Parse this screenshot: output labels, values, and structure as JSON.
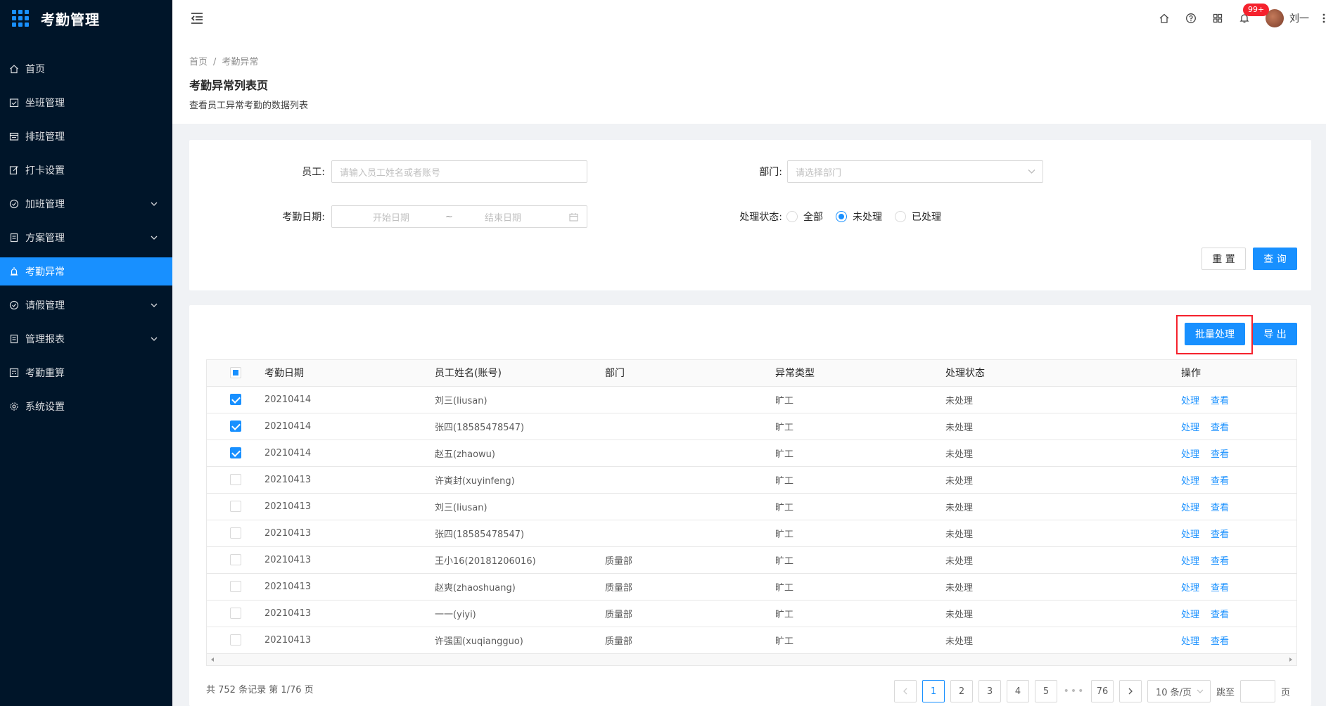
{
  "app": {
    "title": "考勤管理"
  },
  "sidebar": {
    "items": [
      {
        "label": "首页",
        "icon": "home-icon"
      },
      {
        "label": "坐班管理",
        "icon": "calendar-check-icon"
      },
      {
        "label": "排班管理",
        "icon": "schedule-icon"
      },
      {
        "label": "打卡设置",
        "icon": "edit-icon"
      },
      {
        "label": "加班管理",
        "icon": "clock-icon",
        "expandable": true
      },
      {
        "label": "方案管理",
        "icon": "document-icon",
        "expandable": true
      },
      {
        "label": "考勤异常",
        "icon": "alert-icon",
        "active": true
      },
      {
        "label": "请假管理",
        "icon": "clock-icon",
        "expandable": true
      },
      {
        "label": "管理报表",
        "icon": "document-icon",
        "expandable": true
      },
      {
        "label": "考勤重算",
        "icon": "calculator-icon"
      },
      {
        "label": "系统设置",
        "icon": "gear-icon"
      }
    ]
  },
  "header": {
    "notification_count": "99+",
    "user_name": "刘一"
  },
  "page": {
    "breadcrumb": [
      "首页",
      "考勤异常"
    ],
    "breadcrumb_sep": "/",
    "title": "考勤异常列表页",
    "description": "查看员工异常考勤的数据列表"
  },
  "search": {
    "employee_label": "员工:",
    "employee_placeholder": "请输入员工姓名或者账号",
    "dept_label": "部门:",
    "dept_placeholder": "请选择部门",
    "date_label": "考勤日期:",
    "start_placeholder": "开始日期",
    "range_sep": "~",
    "end_placeholder": "结束日期",
    "status_label": "处理状态:",
    "status_options": [
      "全部",
      "未处理",
      "已处理"
    ],
    "status_selected": "未处理",
    "reset_label": "重 置",
    "query_label": "查 询"
  },
  "toolbar": {
    "batch_label": "批量处理",
    "export_label": "导 出"
  },
  "table": {
    "columns": [
      "考勤日期",
      "员工姓名(账号)",
      "部门",
      "异常类型",
      "处理状态",
      "操作"
    ],
    "action_process": "处理",
    "action_view": "查看",
    "rows": [
      {
        "checked": true,
        "date": "20210414",
        "name": "刘三(liusan)",
        "dept": "",
        "type": "旷工",
        "status": "未处理"
      },
      {
        "checked": true,
        "date": "20210414",
        "name": "张四(18585478547)",
        "dept": "",
        "type": "旷工",
        "status": "未处理"
      },
      {
        "checked": true,
        "date": "20210414",
        "name": "赵五(zhaowu)",
        "dept": "",
        "type": "旷工",
        "status": "未处理"
      },
      {
        "checked": false,
        "date": "20210413",
        "name": "许寅封(xuyinfeng)",
        "dept": "",
        "type": "旷工",
        "status": "未处理"
      },
      {
        "checked": false,
        "date": "20210413",
        "name": "刘三(liusan)",
        "dept": "",
        "type": "旷工",
        "status": "未处理"
      },
      {
        "checked": false,
        "date": "20210413",
        "name": "张四(18585478547)",
        "dept": "",
        "type": "旷工",
        "status": "未处理"
      },
      {
        "checked": false,
        "date": "20210413",
        "name": "王小16(20181206016)",
        "dept": "质量部",
        "type": "旷工",
        "status": "未处理"
      },
      {
        "checked": false,
        "date": "20210413",
        "name": "赵爽(zhaoshuang)",
        "dept": "质量部",
        "type": "旷工",
        "status": "未处理"
      },
      {
        "checked": false,
        "date": "20210413",
        "name": "一一(yiyi)",
        "dept": "质量部",
        "type": "旷工",
        "status": "未处理"
      },
      {
        "checked": false,
        "date": "20210413",
        "name": "许强国(xuqiangguo)",
        "dept": "质量部",
        "type": "旷工",
        "status": "未处理"
      }
    ]
  },
  "pagination": {
    "total_text": "共 752 条记录 第 1/76 页",
    "pages": [
      "1",
      "2",
      "3",
      "4",
      "5"
    ],
    "current": "1",
    "dots": "•••",
    "last": "76",
    "page_size": "10 条/页",
    "jump_label": "跳至",
    "page_unit": "页"
  },
  "colors": {
    "primary": "#1890ff",
    "sidebar_bg": "#001529",
    "highlight": "#f5222d"
  }
}
